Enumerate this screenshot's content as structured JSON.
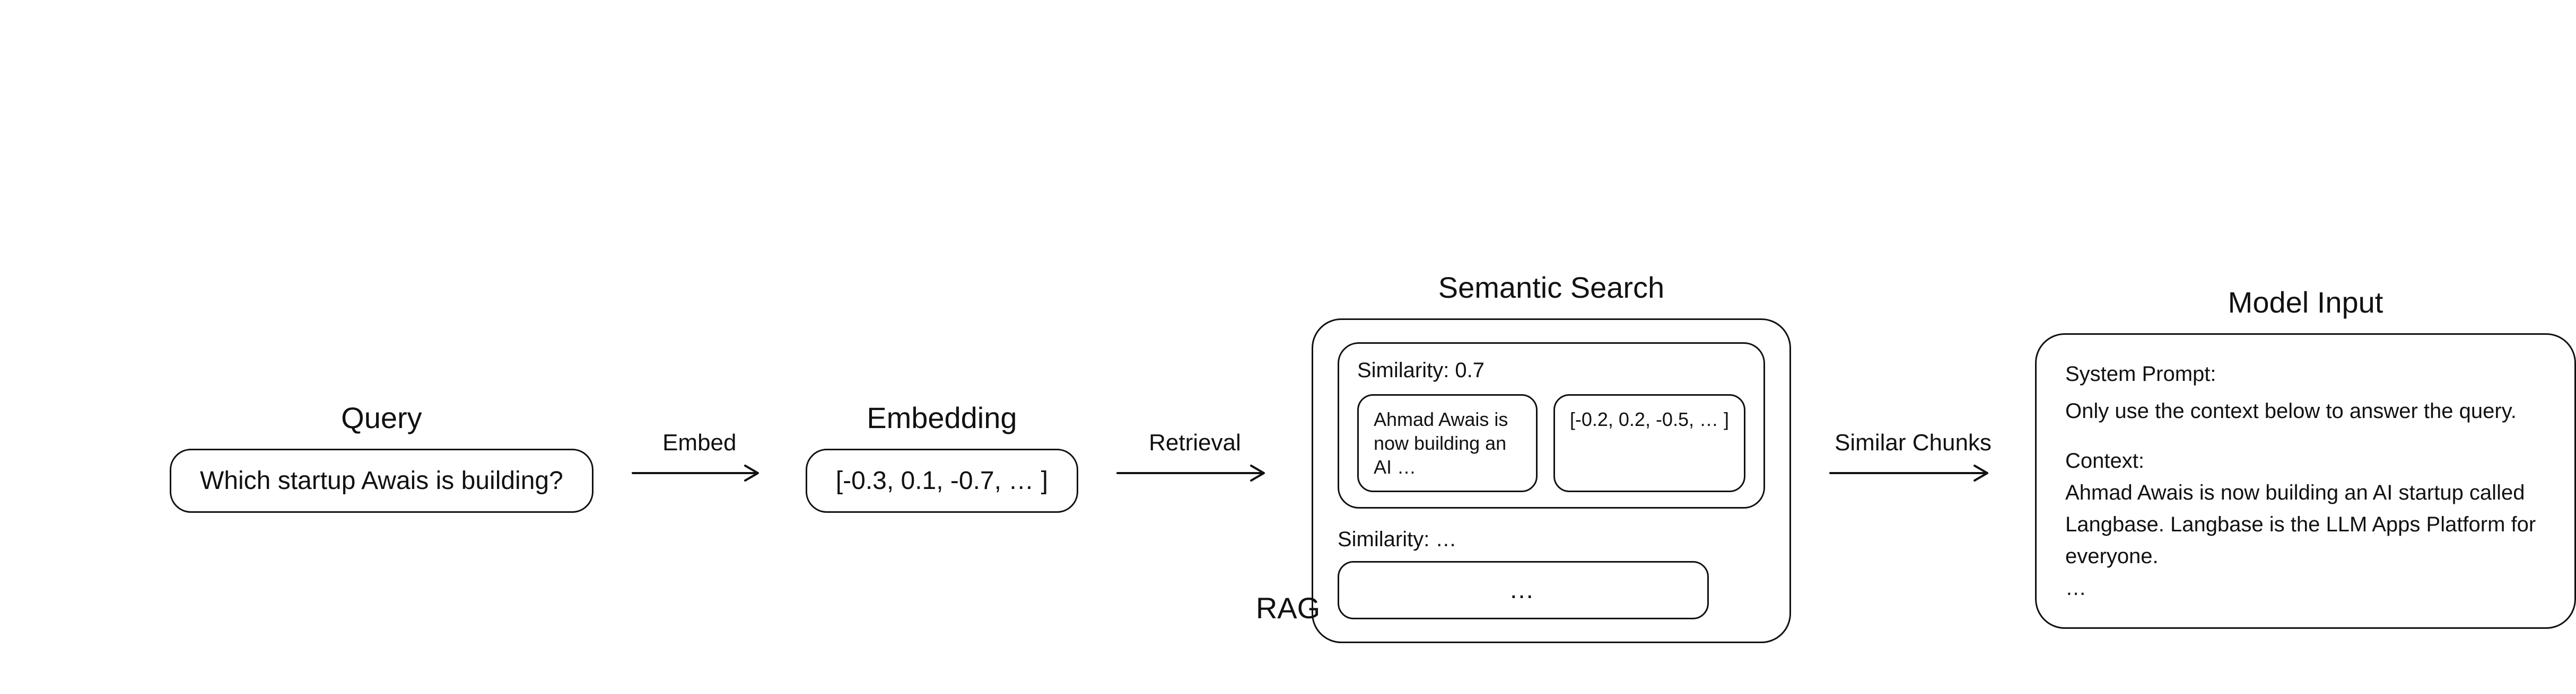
{
  "caption": "RAG",
  "query": {
    "title": "Query",
    "text": "Which startup Awais is building?"
  },
  "arrows": {
    "embed": "Embed",
    "retrieval": "Retrieval",
    "similar": "Similar Chunks"
  },
  "embedding": {
    "title": "Embedding",
    "vector": "[-0.3, 0.1, -0.7, … ]"
  },
  "search": {
    "title": "Semantic Search",
    "top": {
      "similarity_label": "Similarity: 0.7",
      "chunk_text": "Ahmad Awais is now building an AI …",
      "chunk_vector": "[-0.2, 0.2, -0.5, … ]"
    },
    "rest": {
      "similarity_label": "Similarity: …",
      "chunk_placeholder": "…"
    }
  },
  "model_input": {
    "title": "Model Input",
    "system_label": "System Prompt:",
    "system_text": "Only use the context below to answer the query.",
    "context_label": "Context:",
    "context_text": "Ahmad Awais is now building an AI startup called Langbase. Langbase is the LLM Apps Platform for everyone.",
    "context_ellipsis": "…"
  }
}
